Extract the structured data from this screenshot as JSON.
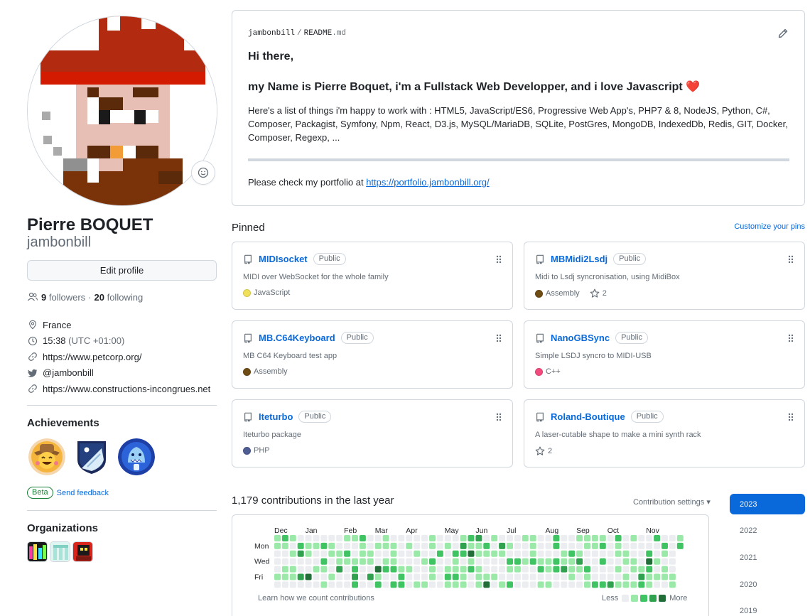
{
  "profile": {
    "name": "Pierre BOQUET",
    "login": "jambonbill",
    "edit_label": "Edit profile",
    "followers_count": "9",
    "followers_label": "followers",
    "separator": "·",
    "following_count": "20",
    "following_label": "following",
    "location": "France",
    "local_time": "15:38",
    "timezone": "(UTC +01:00)",
    "website": "https://www.petcorp.org/",
    "twitter": "@jambonbill",
    "website2": "https://www.constructions-incongrues.net"
  },
  "achievements": {
    "title": "Achievements",
    "badges": [
      "cowboy-badge",
      "arctic-code-vault-badge",
      "shark-badge"
    ],
    "beta_label": "Beta",
    "feedback_label": "Send feedback"
  },
  "organizations": {
    "title": "Organizations",
    "items": [
      "org-1",
      "org-2",
      "org-3"
    ]
  },
  "readme": {
    "owner": "jambonbill",
    "sep": "/",
    "file_base": "README",
    "file_ext": ".md",
    "heading1": "Hi there,",
    "heading2": "my Name is Pierre Boquet, i'm a Fullstack Web Developper, and i love Javascript",
    "heart": "❤️",
    "skills_text": "Here's a list of things i'm happy to work with : HTML5, JavaScript/ES6, Progressive Web App's, PHP7 & 8, NodeJS, Python, C#, Composer, Packagist, Symfony, Npm, React, D3.js, MySQL/MariaDB, SQLite, PostGres, MongoDB, IndexedDb, Redis, GIT, Docker, Composer, Regexp, ...",
    "portfolio_prefix": "Please check my portfolio at ",
    "portfolio_link": "https://portfolio.jambonbill.org/"
  },
  "pinned": {
    "title": "Pinned",
    "customize_label": "Customize your pins",
    "public_label": "Public",
    "repos": [
      {
        "name": "MIDIsocket",
        "desc": "MIDI over WebSocket for the whole family",
        "lang": "JavaScript",
        "color": "#f1e05a",
        "stars": ""
      },
      {
        "name": "MBMidi2Lsdj",
        "desc": "Midi to Lsdj syncronisation, using MidiBox",
        "lang": "Assembly",
        "color": "#6e4c13",
        "stars": "2"
      },
      {
        "name": "MB.C64Keyboard",
        "desc": "MB C64 Keyboard test app",
        "lang": "Assembly",
        "color": "#6e4c13",
        "stars": ""
      },
      {
        "name": "NanoGBSync",
        "desc": "Simple LSDJ syncro to MIDI-USB",
        "lang": "C++",
        "color": "#f34b7d",
        "stars": ""
      },
      {
        "name": "Iteturbo",
        "desc": "Iteturbo package",
        "lang": "PHP",
        "color": "#4f5d95",
        "stars": ""
      },
      {
        "name": "Roland-Boutique",
        "desc": "A laser-cutable shape to make a mini synth rack",
        "lang": "",
        "color": "",
        "stars": "2"
      }
    ]
  },
  "contributions": {
    "title": "1,179 contributions in the last year",
    "settings_label": "Contribution settings ▾",
    "months": [
      "Dec",
      "Jan",
      "Feb",
      "Mar",
      "Apr",
      "May",
      "Jun",
      "Jul",
      "Aug",
      "Sep",
      "Oct",
      "Nov"
    ],
    "days": [
      "Mon",
      "Wed",
      "Fri"
    ],
    "learn_label": "Learn how we count contributions",
    "less_label": "Less",
    "more_label": "More",
    "levels": [
      "#ebedf0",
      "#9be9a8",
      "#40c463",
      "#30a14e",
      "#216e39"
    ],
    "weeks": 53
  },
  "years": [
    "2023",
    "2022",
    "2021",
    "2020",
    "2019"
  ]
}
